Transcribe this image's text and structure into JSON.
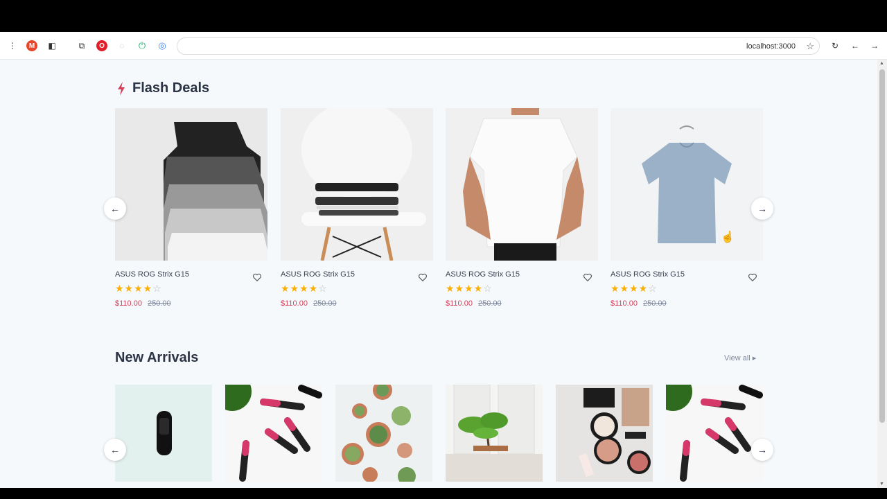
{
  "browser": {
    "url": "localhost:3000",
    "icons": [
      "menu-dots-icon",
      "extension-m-icon",
      "sidebar-icon",
      "puzzle-icon",
      "opera-icon",
      "extension-grey-icon",
      "power-icon",
      "circle-extension-icon",
      "bookmark-star-icon",
      "reload-icon",
      "back-icon",
      "forward-icon"
    ],
    "extension_m_label": "M"
  },
  "flash_deals": {
    "title": "Flash Deals",
    "products": [
      {
        "name": "ASUS ROG Strix G15",
        "price": "$110.00",
        "old_price": "250.00",
        "rating": 4,
        "image": "camisole-tank-tops"
      },
      {
        "name": "ASUS ROG Strix G15",
        "price": "$110.00",
        "old_price": "250.00",
        "rating": 4,
        "image": "folded-clothes-on-chair"
      },
      {
        "name": "ASUS ROG Strix G15",
        "price": "$110.00",
        "old_price": "250.00",
        "rating": 4,
        "image": "man-white-tshirt"
      },
      {
        "name": "ASUS ROG Strix G15",
        "price": "$110.00",
        "old_price": "250.00",
        "rating": 4,
        "image": "blue-tshirt-on-hanger"
      }
    ]
  },
  "new_arrivals": {
    "title": "New Arrivals",
    "view_all": "View all",
    "items": [
      {
        "image": "fitness-band"
      },
      {
        "image": "lipsticks"
      },
      {
        "image": "succulents"
      },
      {
        "image": "bonsai"
      },
      {
        "image": "makeup-palette"
      },
      {
        "image": "lipsticks"
      }
    ]
  },
  "colors": {
    "accent": "#d23f57",
    "star": "#faaf00",
    "heading": "#2b3445",
    "page_bg": "#f6f9fc"
  }
}
